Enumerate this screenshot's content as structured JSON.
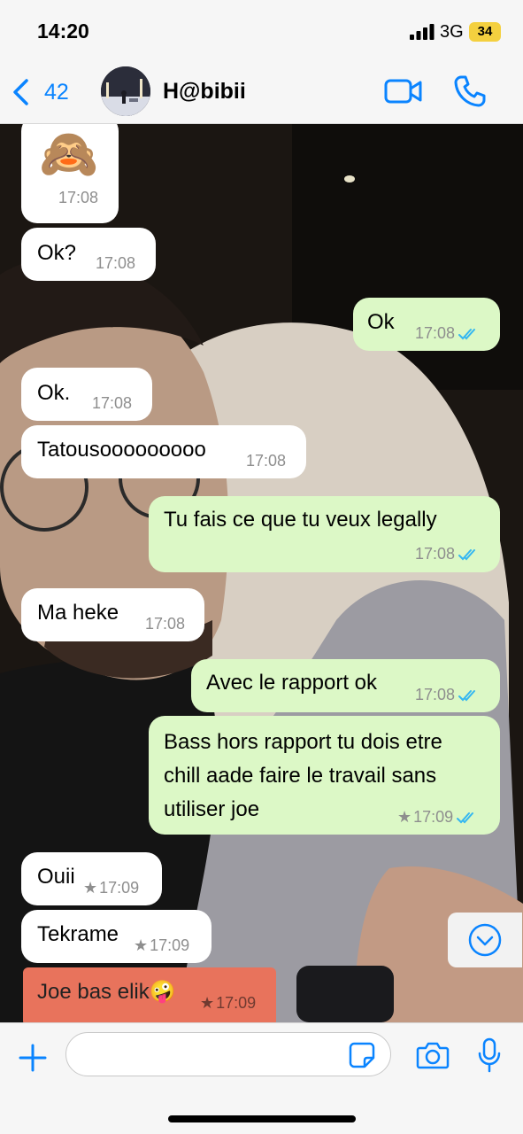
{
  "status": {
    "time": "14:20",
    "network": "3G",
    "battery": "34"
  },
  "header": {
    "back_count": "42",
    "contact_name": "H@bibii"
  },
  "messages": [
    {
      "dir": "in",
      "time": "17:08",
      "emoji": "🙈"
    },
    {
      "dir": "in",
      "text": "Ok?",
      "time": "17:08"
    },
    {
      "dir": "out",
      "text": "Ok",
      "time": "17:08",
      "read": true
    },
    {
      "dir": "in",
      "text": "Ok.",
      "time": "17:08"
    },
    {
      "dir": "in",
      "text": "Tatousooooooooo",
      "time": "17:08"
    },
    {
      "dir": "out",
      "text": "Tu fais ce que tu veux legally",
      "time": "17:08",
      "read": true
    },
    {
      "dir": "in",
      "text": "Ma heke",
      "time": "17:08"
    },
    {
      "dir": "out",
      "text": "Avec le rapport ok",
      "time": "17:08",
      "read": true
    },
    {
      "dir": "out",
      "text": "Bass hors rapport tu dois etre\nchill aade faire le travail sans\nutiliser joe",
      "time": "17:09",
      "read": true,
      "starred": true
    },
    {
      "dir": "in",
      "text": "Ouii",
      "time": "17:09",
      "starred": true
    },
    {
      "dir": "in",
      "text": "Tekrame",
      "time": "17:09",
      "starred": true
    },
    {
      "dir": "in",
      "text": "Joe bas elik🤪",
      "time": "17:09",
      "starred": true,
      "highlighted": true,
      "highlight_color": "#e8735c"
    }
  ],
  "icons": {
    "back": "chevron-left-icon",
    "video": "video-camera-icon",
    "call": "phone-icon",
    "scroll": "chevron-down-circle-icon",
    "plus": "plus-icon",
    "sticker": "sticker-icon",
    "camera": "camera-icon",
    "mic": "microphone-icon"
  },
  "colors": {
    "accent": "#0a84ff",
    "outgoing_bubble": "#dcf8c6",
    "incoming_bubble": "#ffffff",
    "read_ticks": "#34b7f1"
  }
}
